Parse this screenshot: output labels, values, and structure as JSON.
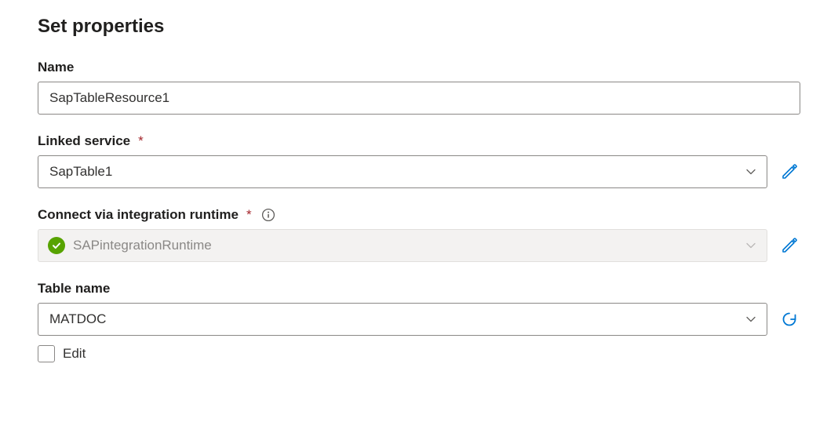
{
  "title": "Set properties",
  "name": {
    "label": "Name",
    "value": "SapTableResource1"
  },
  "linkedService": {
    "label": "Linked service",
    "required": "*",
    "value": "SapTable1"
  },
  "integrationRuntime": {
    "label": "Connect via integration runtime",
    "required": "*",
    "value": "SAPintegrationRuntime"
  },
  "tableName": {
    "label": "Table name",
    "value": "MATDOC",
    "editLabel": "Edit"
  }
}
